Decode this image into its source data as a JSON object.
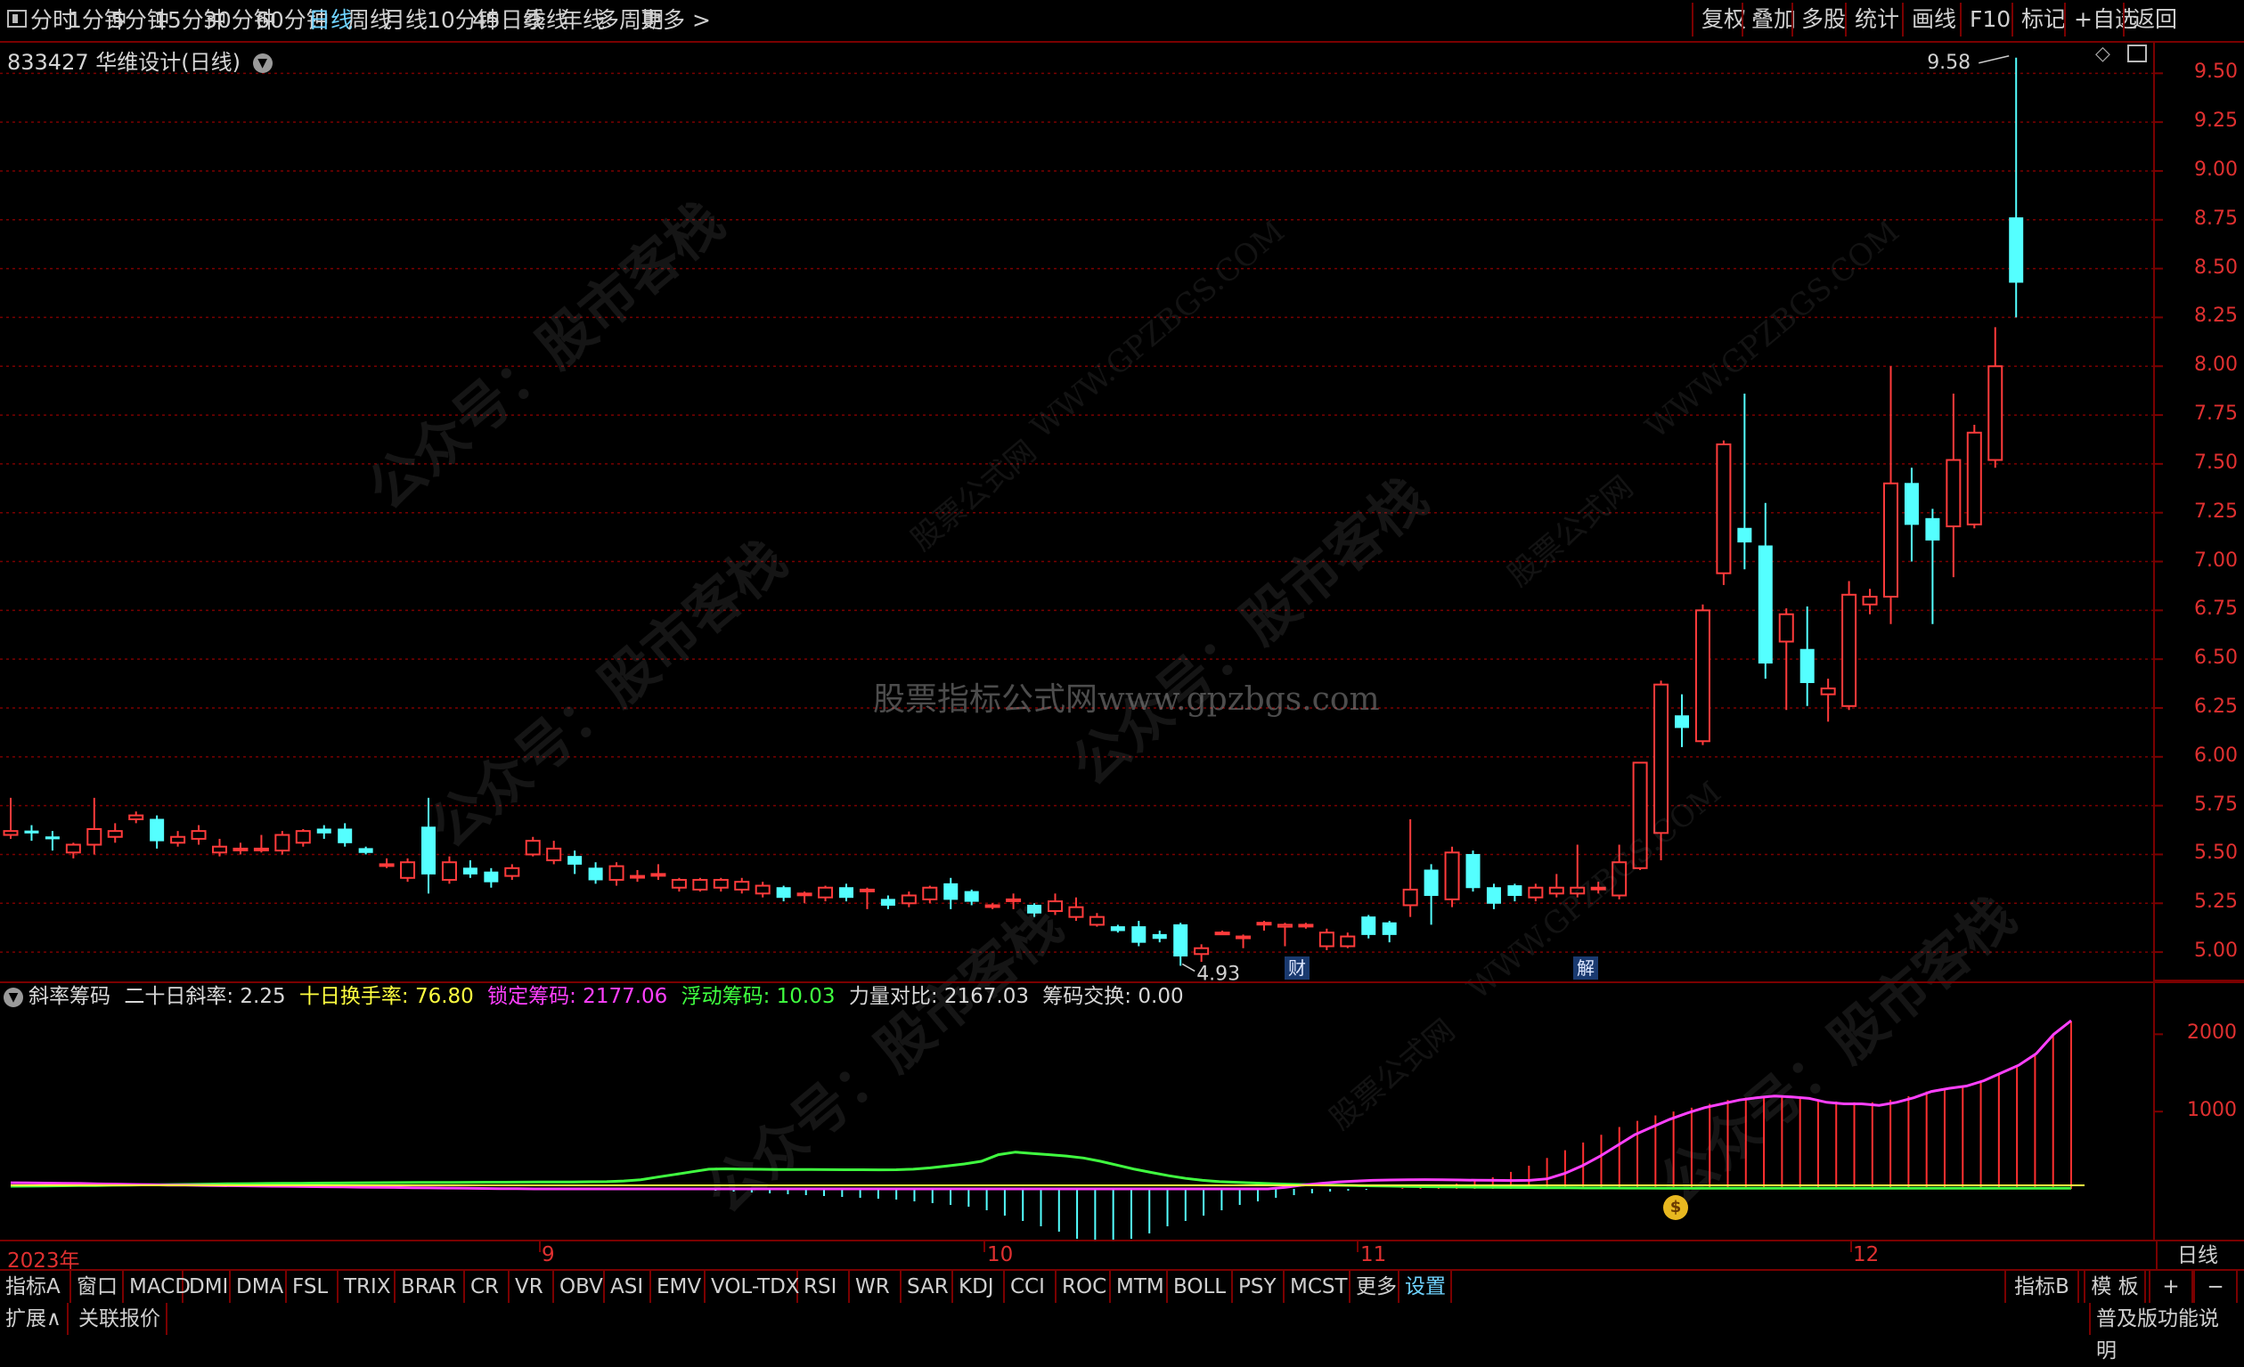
{
  "toolbar": {
    "periods": [
      "分时",
      "1分钟",
      "5分钟",
      "15分钟",
      "30分钟",
      "60分钟",
      "日线",
      "周线",
      "月线",
      "10分钟",
      "45日线",
      "季线",
      "年线",
      "多周期",
      "更多 >"
    ],
    "active_period": "日线",
    "right_buttons": [
      "复权",
      "叠加",
      "多股",
      "统计",
      "画线",
      "F10",
      "标记",
      "+自选",
      "返回"
    ]
  },
  "stock": {
    "code": "833427",
    "name": "华维设计",
    "period_label": "(日线)"
  },
  "price_axis": {
    "labels": [
      "9.50",
      "9.25",
      "9.00",
      "8.75",
      "8.50",
      "8.25",
      "8.00",
      "7.75",
      "7.50",
      "7.25",
      "7.00",
      "6.75",
      "6.50",
      "6.25",
      "6.00",
      "5.75",
      "5.50",
      "5.25",
      "5.00"
    ],
    "min": 4.85,
    "max": 9.62
  },
  "markers": {
    "high": "9.58",
    "low": "4.93",
    "tag_cai": "财",
    "tag_jie": "解"
  },
  "watermarks": {
    "center": "股票指标公式网www.gpzbgs.com",
    "brand": "公众号：股市客栈",
    "site": "WWW.GPZBGS.COM",
    "site_cn": "股票公式网"
  },
  "indicator": {
    "name": "斜率筹码",
    "items": [
      {
        "label": "二十日斜率: ",
        "value": "2.25",
        "color": "#d8d8d8"
      },
      {
        "label": "十日换手率: ",
        "value": "76.80",
        "color": "#ffff40"
      },
      {
        "label": "锁定筹码: ",
        "value": "2177.06",
        "color": "#ff40ff"
      },
      {
        "label": "浮动筹码: ",
        "value": "10.03",
        "color": "#40ff40"
      },
      {
        "label": "力量对比: ",
        "value": "2167.03",
        "color": "#d8d8d8"
      },
      {
        "label": "筹码交换: ",
        "value": "0.00",
        "color": "#d8d8d8"
      }
    ],
    "axis_labels": [
      "2000",
      "1000"
    ]
  },
  "time_axis": {
    "labels": [
      "2023年",
      "9",
      "10",
      "11",
      "12"
    ],
    "right_label": "日线"
  },
  "bottom_tabs": [
    "指标A",
    "窗口",
    "MACD",
    "DMI",
    "DMA",
    "FSL",
    "TRIX",
    "BRAR",
    "CR",
    "VR",
    "OBV",
    "ASI",
    "EMV",
    "VOL-TDX",
    "RSI",
    "WR",
    "SAR",
    "KDJ",
    "CCI",
    "ROC",
    "MTM",
    "BOLL",
    "PSY",
    "MCST",
    "更多",
    "设置"
  ],
  "active_tab": "设置",
  "bottom_right": [
    "指标B",
    "模 板",
    "+",
    "−"
  ],
  "status": {
    "left": [
      "扩展∧",
      "关联报价"
    ],
    "right": "普及版功能说明"
  },
  "colors": {
    "up": "#ff3b3b",
    "down": "#54ffff",
    "grid": "#7a0000",
    "locked": "#ff40ff",
    "float": "#40ff40",
    "turnover": "#ffff40",
    "bars_up": "#ff3030",
    "bars_down": "#54ffff"
  },
  "chart_data": {
    "type": "candlestick",
    "candles": [
      [
        5.6,
        5.62,
        5.79,
        5.58
      ],
      [
        5.62,
        5.61,
        5.65,
        5.57
      ],
      [
        5.59,
        5.58,
        5.62,
        5.52
      ],
      [
        5.51,
        5.55,
        5.56,
        5.48
      ],
      [
        5.55,
        5.63,
        5.79,
        5.5
      ],
      [
        5.59,
        5.62,
        5.66,
        5.56
      ],
      [
        5.68,
        5.7,
        5.72,
        5.66
      ],
      [
        5.68,
        5.57,
        5.7,
        5.53
      ],
      [
        5.56,
        5.59,
        5.62,
        5.54
      ],
      [
        5.58,
        5.62,
        5.65,
        5.55
      ],
      [
        5.51,
        5.54,
        5.58,
        5.49
      ],
      [
        5.53,
        5.53,
        5.56,
        5.5
      ],
      [
        5.53,
        5.53,
        5.6,
        5.51
      ],
      [
        5.52,
        5.6,
        5.62,
        5.5
      ],
      [
        5.56,
        5.62,
        5.63,
        5.54
      ],
      [
        5.63,
        5.61,
        5.65,
        5.58
      ],
      [
        5.63,
        5.56,
        5.66,
        5.54
      ],
      [
        5.53,
        5.51,
        5.54,
        5.5
      ],
      [
        5.45,
        5.45,
        5.48,
        5.43
      ],
      [
        5.38,
        5.46,
        5.48,
        5.36
      ],
      [
        5.64,
        5.4,
        5.79,
        5.3
      ],
      [
        5.37,
        5.46,
        5.49,
        5.35
      ],
      [
        5.43,
        5.4,
        5.47,
        5.38
      ],
      [
        5.41,
        5.36,
        5.43,
        5.33
      ],
      [
        5.39,
        5.43,
        5.45,
        5.37
      ],
      [
        5.5,
        5.57,
        5.59,
        5.49
      ],
      [
        5.47,
        5.53,
        5.57,
        5.45
      ],
      [
        5.49,
        5.45,
        5.52,
        5.4
      ],
      [
        5.43,
        5.37,
        5.46,
        5.35
      ],
      [
        5.37,
        5.44,
        5.46,
        5.34
      ],
      [
        5.39,
        5.39,
        5.42,
        5.36
      ],
      [
        5.4,
        5.4,
        5.45,
        5.37
      ],
      [
        5.33,
        5.37,
        5.38,
        5.31
      ],
      [
        5.32,
        5.37,
        5.38,
        5.31
      ],
      [
        5.33,
        5.37,
        5.38,
        5.31
      ],
      [
        5.32,
        5.36,
        5.38,
        5.3
      ],
      [
        5.3,
        5.34,
        5.36,
        5.28
      ],
      [
        5.33,
        5.28,
        5.34,
        5.26
      ],
      [
        5.3,
        5.3,
        5.31,
        5.25
      ],
      [
        5.28,
        5.33,
        5.34,
        5.26
      ],
      [
        5.33,
        5.28,
        5.35,
        5.26
      ],
      [
        5.32,
        5.32,
        5.33,
        5.22
      ],
      [
        5.27,
        5.24,
        5.29,
        5.22
      ],
      [
        5.25,
        5.29,
        5.31,
        5.23
      ],
      [
        5.27,
        5.33,
        5.34,
        5.25
      ],
      [
        5.35,
        5.27,
        5.38,
        5.22
      ],
      [
        5.31,
        5.26,
        5.32,
        5.24
      ],
      [
        5.24,
        5.24,
        5.25,
        5.22
      ],
      [
        5.27,
        5.27,
        5.3,
        5.22
      ],
      [
        5.24,
        5.2,
        5.25,
        5.18
      ],
      [
        5.21,
        5.26,
        5.3,
        5.19
      ],
      [
        5.18,
        5.23,
        5.28,
        5.16
      ],
      [
        5.14,
        5.18,
        5.2,
        5.13
      ],
      [
        5.13,
        5.11,
        5.14,
        5.1
      ],
      [
        5.13,
        5.05,
        5.16,
        5.03
      ],
      [
        5.09,
        5.07,
        5.11,
        5.05
      ],
      [
        5.14,
        4.98,
        5.15,
        4.93
      ],
      [
        4.99,
        5.02,
        5.04,
        4.95
      ],
      [
        5.1,
        5.1,
        5.11,
        5.09
      ],
      [
        5.08,
        5.08,
        5.09,
        5.02
      ],
      [
        5.15,
        5.15,
        5.16,
        5.11
      ],
      [
        5.13,
        5.14,
        5.15,
        5.03
      ],
      [
        5.14,
        5.14,
        5.15,
        5.12
      ],
      [
        5.03,
        5.1,
        5.12,
        5.01
      ],
      [
        5.03,
        5.08,
        5.1,
        5.02
      ],
      [
        5.18,
        5.09,
        5.19,
        5.07
      ],
      [
        5.15,
        5.09,
        5.16,
        5.05
      ],
      [
        5.24,
        5.32,
        5.68,
        5.18
      ],
      [
        5.42,
        5.29,
        5.45,
        5.14
      ],
      [
        5.27,
        5.51,
        5.54,
        5.23
      ],
      [
        5.5,
        5.33,
        5.52,
        5.31
      ],
      [
        5.33,
        5.25,
        5.35,
        5.22
      ],
      [
        5.34,
        5.29,
        5.35,
        5.26
      ],
      [
        5.28,
        5.33,
        5.35,
        5.26
      ],
      [
        5.3,
        5.33,
        5.4,
        5.28
      ],
      [
        5.3,
        5.33,
        5.55,
        5.28
      ],
      [
        5.33,
        5.33,
        5.36,
        5.3
      ],
      [
        5.29,
        5.46,
        5.55,
        5.27
      ],
      [
        5.43,
        5.97,
        5.61,
        5.42
      ],
      [
        5.61,
        6.37,
        6.39,
        5.47
      ],
      [
        6.21,
        6.15,
        6.32,
        6.05
      ],
      [
        6.08,
        6.75,
        6.78,
        6.06
      ],
      [
        6.94,
        7.6,
        7.62,
        6.88
      ],
      [
        7.17,
        7.1,
        7.86,
        6.96
      ],
      [
        7.08,
        6.48,
        7.3,
        6.4
      ],
      [
        6.59,
        6.73,
        6.76,
        6.24
      ],
      [
        6.55,
        6.38,
        6.77,
        6.26
      ],
      [
        6.32,
        6.35,
        6.4,
        6.18
      ],
      [
        6.26,
        6.83,
        6.9,
        6.24
      ],
      [
        6.78,
        6.82,
        6.86,
        6.73
      ],
      [
        6.82,
        7.4,
        8.0,
        6.68
      ],
      [
        7.4,
        7.19,
        7.48,
        7.0
      ],
      [
        7.22,
        7.11,
        7.27,
        6.68
      ],
      [
        7.18,
        7.52,
        7.86,
        6.92
      ],
      [
        7.19,
        7.66,
        7.7,
        7.17
      ],
      [
        7.52,
        8.0,
        8.2,
        7.48
      ],
      [
        8.76,
        8.43,
        9.58,
        8.25
      ]
    ],
    "locked_chips": [
      80,
      78,
      75,
      72,
      70,
      65,
      62,
      58,
      55,
      50,
      48,
      45,
      42,
      40,
      38,
      35,
      33,
      30,
      28,
      25,
      22,
      20,
      18,
      15,
      13,
      10,
      8,
      6,
      4,
      2,
      0,
      0,
      0,
      0,
      0,
      0,
      0,
      0,
      0,
      0,
      0,
      0,
      0,
      0,
      0,
      0,
      0,
      0,
      0,
      0,
      0,
      0,
      0,
      0,
      0,
      0,
      0,
      0,
      0,
      0,
      0,
      0,
      0,
      0,
      0,
      0,
      0,
      0,
      0,
      0,
      0,
      0,
      0,
      20,
      50,
      70,
      90,
      100,
      110,
      115,
      118,
      120,
      118,
      115,
      112,
      110,
      108,
      110,
      130,
      200,
      300,
      420,
      560,
      700,
      800,
      900,
      980,
      1050,
      1100,
      1150,
      1180,
      1200,
      1190,
      1170,
      1120,
      1100,
      1100,
      1080,
      1120,
      1180,
      1260,
      1300,
      1330,
      1400,
      1500,
      1600,
      1750,
      2000,
      2177
    ],
    "float_chips": [
      40,
      42,
      45,
      48,
      50,
      52,
      55,
      58,
      62,
      65,
      68,
      72,
      75,
      78,
      80,
      82,
      84,
      86,
      88,
      90,
      92,
      94,
      95,
      96,
      97,
      98,
      99,
      100,
      101,
      102,
      103,
      104,
      105,
      106,
      108,
      110,
      120,
      140,
      180,
      220,
      260,
      300,
      305,
      300,
      298,
      296,
      295,
      294,
      293,
      292,
      291,
      290,
      292,
      300,
      320,
      350,
      380,
      420,
      520,
      560,
      540,
      520,
      500,
      470,
      420,
      360,
      300,
      250,
      200,
      160,
      130,
      110,
      100,
      90,
      80,
      72,
      66,
      60,
      55,
      50,
      46,
      42,
      38,
      34,
      30,
      28,
      26,
      24,
      22,
      20,
      18,
      16,
      15,
      14,
      13,
      12,
      12,
      11,
      11,
      11,
      10,
      10,
      10,
      10,
      10,
      10,
      10,
      10,
      10,
      10,
      10,
      10,
      10,
      10,
      10,
      10,
      10,
      10,
      10,
      10,
      10,
      10
    ],
    "power_bars": [
      0,
      0,
      0,
      0,
      0,
      0,
      0,
      0,
      0,
      0,
      0,
      0,
      0,
      0,
      0,
      0,
      0,
      0,
      0,
      0,
      0,
      0,
      0,
      0,
      0,
      0,
      0,
      0,
      0,
      0,
      0,
      0,
      0,
      0,
      0,
      0,
      0,
      0,
      0,
      -20,
      -30,
      -40,
      -50,
      -60,
      -70,
      -80,
      -90,
      -100,
      -110,
      -120,
      -140,
      -160,
      -180,
      -200,
      -240,
      -300,
      -360,
      -420,
      -480,
      -560,
      -600,
      -600,
      -560,
      -500,
      -420,
      -360,
      -300,
      -240,
      -180,
      -140,
      -100,
      -70,
      -50,
      -30,
      -20,
      -10,
      0,
      10,
      20,
      40,
      70,
      100,
      150,
      220,
      300,
      400,
      500,
      600,
      700,
      800,
      880,
      950,
      1000,
      1050,
      1100,
      1150,
      1180,
      1200,
      1190,
      1170,
      1150,
      1130,
      1120,
      1120,
      1150,
      1200,
      1260,
      1300,
      1330,
      1400,
      1500,
      1600,
      1750,
      2000,
      2167
    ]
  }
}
